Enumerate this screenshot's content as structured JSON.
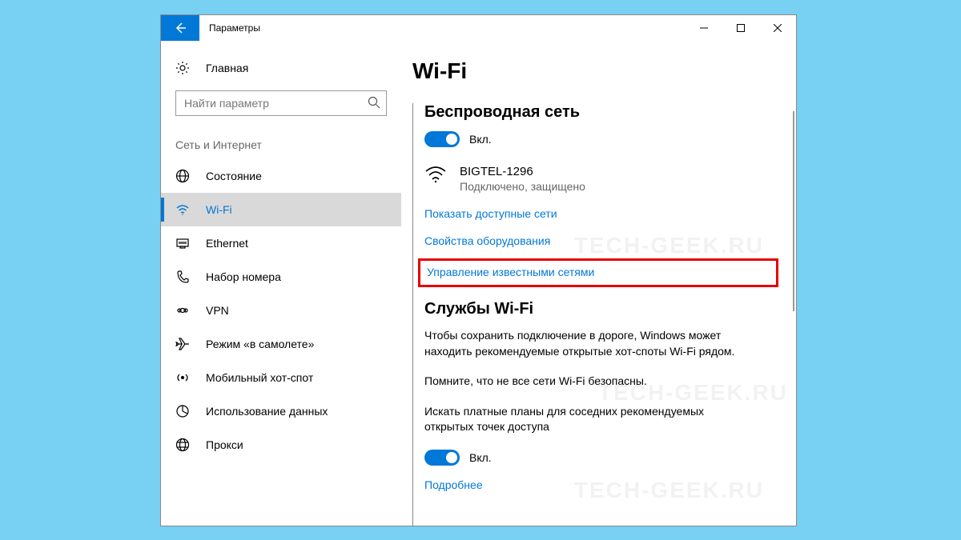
{
  "window": {
    "title": "Параметры"
  },
  "sidebar": {
    "home": "Главная",
    "search_placeholder": "Найти параметр",
    "category": "Сеть и Интернет",
    "items": [
      {
        "label": "Состояние"
      },
      {
        "label": "Wi-Fi"
      },
      {
        "label": "Ethernet"
      },
      {
        "label": "Набор номера"
      },
      {
        "label": "VPN"
      },
      {
        "label": "Режим «в самолете»"
      },
      {
        "label": "Мобильный хот-спот"
      },
      {
        "label": "Использование данных"
      },
      {
        "label": "Прокси"
      }
    ]
  },
  "main": {
    "heading": "Wi-Fi",
    "wireless_heading": "Беспроводная сеть",
    "toggle_label": "Вкл.",
    "network": {
      "name": "BIGTEL-1296",
      "status": "Подключено, защищено"
    },
    "links": {
      "show_available": "Показать доступные сети",
      "hardware_props": "Свойства оборудования",
      "manage_known": "Управление известными сетями",
      "more": "Подробнее"
    },
    "services_heading": "Службы Wi-Fi",
    "services_text1": "Чтобы сохранить подключение в дороге, Windows может находить рекомендуемые открытые хот-споты Wi-Fi рядом.",
    "services_text2": "Помните, что не все сети Wi-Fi безопасны.",
    "services_text3": "Искать платные планы для соседних рекомендуемых открытых точек доступа",
    "toggle2_label": "Вкл."
  },
  "watermark": "TECH-GEEK.RU"
}
